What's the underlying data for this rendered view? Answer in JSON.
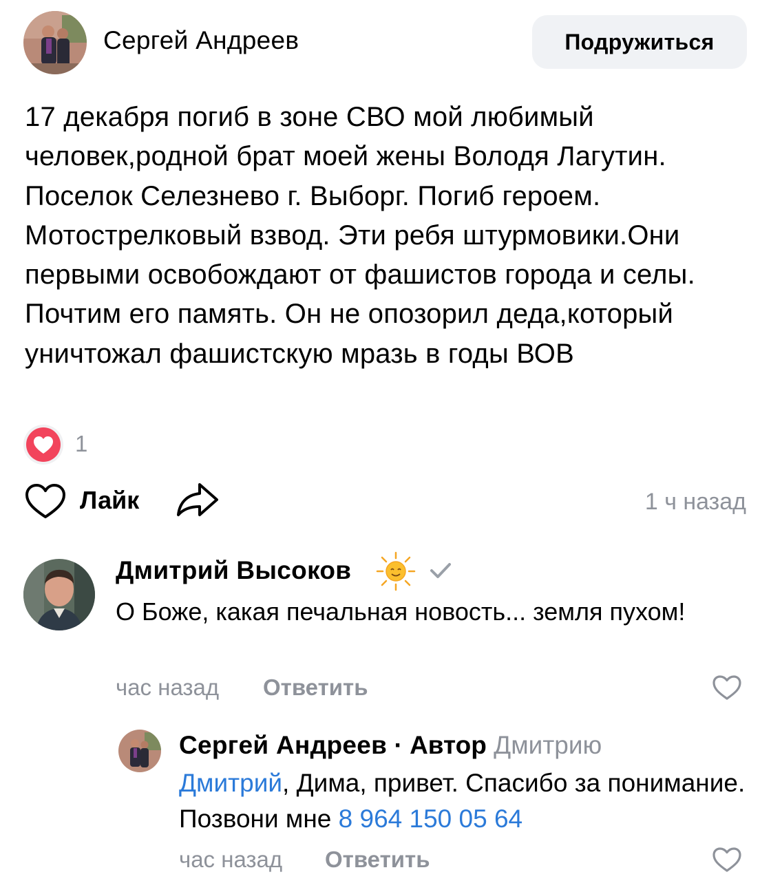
{
  "post": {
    "author_name": "Сергей Андреев",
    "friend_button_label": "Подружиться",
    "text": "17 декабря погиб в зоне СВО мой любимый человек,родной брат моей жены Володя Лагутин. Поселок Селезнево г. Выборг. Погиб героем. Мотострелковый взвод. Эти ребя штурмовики.Они первыми освобождают от фашистов города и селы. Почтим его память. Он не опозорил деда,который уничтожал фашистскую мразь в годы ВОВ",
    "reaction_icon": "heart-icon",
    "reaction_count": "1",
    "like_label": "Лайк",
    "time": "1 ч назад"
  },
  "comments": [
    {
      "author_name": "Дмитрий Высоков",
      "badge_icon": "sun-emoji-icon",
      "verified_icon": "checkmark-icon",
      "text": "О Боже, какая печальная новость... земля пухом!",
      "time": "час назад",
      "reply_label": "Ответить"
    },
    {
      "author_name": "Сергей Андреев",
      "separator": " · ",
      "author_tag": "Автор",
      "reply_to": "Дмитрию",
      "mention": "Дмитрий",
      "text_part1": ", Дима, привет. Спасибо за понимание. Позвони мне ",
      "phone": "8 964 150 05 64",
      "time": "час назад",
      "reply_label": "Ответить"
    }
  ],
  "colors": {
    "accent_link": "#2b7ad9",
    "reaction_red": "#f2445c",
    "secondary_text": "#8e929a",
    "button_bg": "#f0f2f5"
  }
}
